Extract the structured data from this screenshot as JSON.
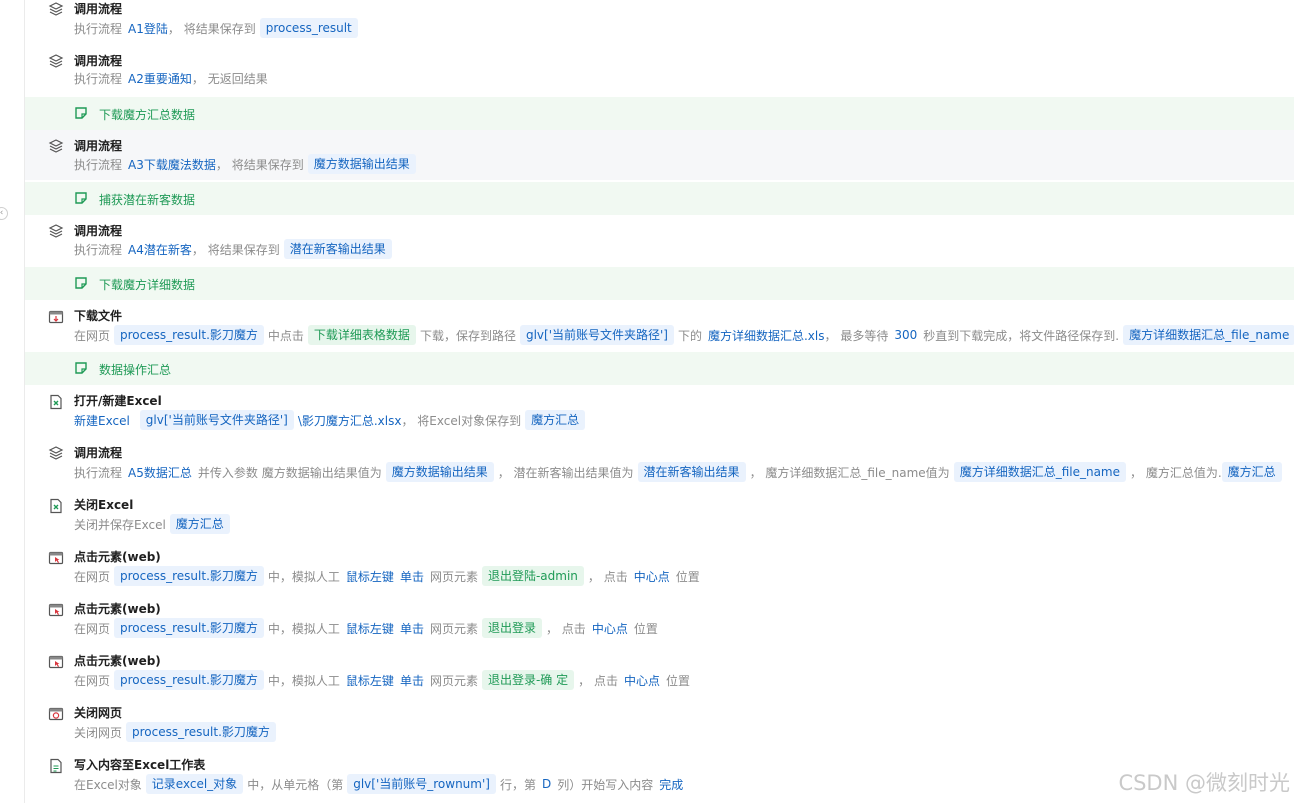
{
  "steps": [
    {
      "kind": "call",
      "title": "调用流程",
      "desc": {
        "p1": "执行流程",
        "flow": "A1登陆",
        "p2": "，  将结果保存到",
        "target": "process_result"
      }
    },
    {
      "kind": "call",
      "title": "调用流程",
      "desc": {
        "p1": "执行流程",
        "flow": "A2重要通知",
        "p2": "，  无返回结果"
      }
    },
    {
      "kind": "group",
      "label": "下载魔方汇总数据"
    },
    {
      "kind": "call",
      "title": "调用流程",
      "desc": {
        "p1": "执行流程",
        "flow": "A3下载魔法数据",
        "p2": "，  将结果保存到",
        "target": "魔方数据输出结果"
      }
    },
    {
      "kind": "group",
      "label": "捕获潜在新客数据"
    },
    {
      "kind": "call",
      "title": "调用流程",
      "desc": {
        "p1": "执行流程",
        "flow": "A4潜在新客",
        "p2": "，  将结果保存到",
        "target": "潜在新客输出结果"
      }
    },
    {
      "kind": "group",
      "label": "下载魔方详细数据"
    },
    {
      "kind": "download",
      "title": "下载文件",
      "desc": {
        "p1": "在网页",
        "page": "process_result.影刀魔方",
        "p2": "中点击",
        "elem": "下载详细表格数据",
        "p3": "下载，保存到路径",
        "path": "glv['当前账号文件夹路径']",
        "p4": "下的",
        "file": "魔方详细数据汇总.xls",
        "p5": "，  最多等待",
        "secs": "300",
        "p6": "秒直到下载完成，将文件路径保存到.",
        "target": "魔方详细数据汇总_file_name"
      }
    },
    {
      "kind": "group",
      "label": "数据操作汇总"
    },
    {
      "kind": "excel-open",
      "title": "打开/新建Excel",
      "desc": {
        "p1": "新建Excel",
        "path": "glv['当前账号文件夹路径']",
        "file": "\\影刀魔方汇总.xlsx",
        "p2": "，  将Excel对象保存到",
        "target": "魔方汇总"
      }
    },
    {
      "kind": "call",
      "title": "调用流程",
      "desc": {
        "p1": "执行流程",
        "flow": "A5数据汇总",
        "p2": "并传入参数 魔方数据输出结果值为",
        "v1": "魔方数据输出结果",
        "p3": "，   潜在新客输出结果值为",
        "v2": "潜在新客输出结果",
        "p4": "，   魔方详细数据汇总_file_name值为",
        "v3": "魔方详细数据汇总_file_name",
        "p5": "，   魔方汇总值为.",
        "v4": "魔方汇总"
      }
    },
    {
      "kind": "excel-close",
      "title": "关闭Excel",
      "desc": {
        "p1": "关闭并保存Excel",
        "target": "魔方汇总"
      }
    },
    {
      "kind": "click",
      "title": "点击元素(web)",
      "desc": {
        "p1": "在网页",
        "page": "process_result.影刀魔方",
        "p2": "中，模拟人工",
        "btn": "鼠标左键",
        "act": "单击",
        "p3": "网页元素",
        "elem": "退出登陆-admin",
        "p4": "，  点击",
        "pos": "中心点",
        "p5": "位置"
      }
    },
    {
      "kind": "click",
      "title": "点击元素(web)",
      "desc": {
        "p1": "在网页",
        "page": "process_result.影刀魔方",
        "p2": "中，模拟人工",
        "btn": "鼠标左键",
        "act": "单击",
        "p3": "网页元素",
        "elem": "退出登录",
        "p4": "，  点击",
        "pos": "中心点",
        "p5": "位置"
      }
    },
    {
      "kind": "click",
      "title": "点击元素(web)",
      "desc": {
        "p1": "在网页",
        "page": "process_result.影刀魔方",
        "p2": "中，模拟人工",
        "btn": "鼠标左键",
        "act": "单击",
        "p3": "网页元素",
        "elem": "退出登录-确 定",
        "p4": "，  点击",
        "pos": "中心点",
        "p5": "位置"
      }
    },
    {
      "kind": "close-web",
      "title": "关闭网页",
      "desc": {
        "p1": "关闭网页",
        "target": "process_result.影刀魔方"
      }
    },
    {
      "kind": "excel-write",
      "title": "写入内容至Excel工作表",
      "desc": {
        "p1": "在Excel对象",
        "obj": "记录excel_对象",
        "p2": "中，从单元格（第",
        "row": "glv['当前账号_rownum']",
        "p3": "行，第",
        "col": "D",
        "p4": "列）开始写入内容",
        "content": "完成"
      }
    }
  ],
  "watermark": "CSDN @微刻时光",
  "colors": {
    "accent": "#1565c0",
    "group_text": "#1f9a56",
    "group_bg": "#f1f9f2",
    "highlight_bg": "#f6f7f9"
  }
}
